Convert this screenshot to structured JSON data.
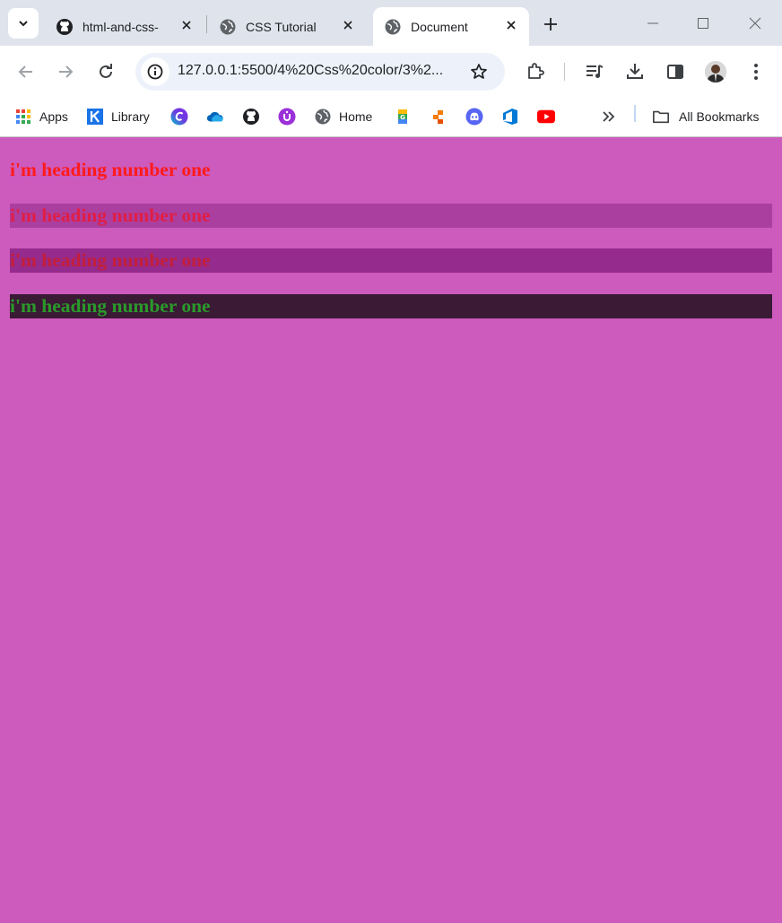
{
  "browser": {
    "tabs": [
      {
        "label": "html-and-css-",
        "icon": "github-icon"
      },
      {
        "label": "CSS Tutorial",
        "icon": "globe-icon"
      },
      {
        "label": "Document",
        "icon": "globe-icon",
        "active": true
      }
    ],
    "address_bar": {
      "url": "127.0.0.1:5500/4%20Css%20color/3%2..."
    },
    "bookmarks": [
      {
        "label": "Apps",
        "icon": "apps-grid-icon"
      },
      {
        "label": "Library",
        "icon": "library-icon"
      },
      {
        "label": "",
        "icon": "canva-icon"
      },
      {
        "label": "",
        "icon": "onedrive-icon"
      },
      {
        "label": "",
        "icon": "github-icon"
      },
      {
        "label": "",
        "icon": "extension-u-icon"
      },
      {
        "label": "Home",
        "icon": "globe-icon"
      },
      {
        "label": "",
        "icon": "google-apps-icon"
      },
      {
        "label": "",
        "icon": "orange-app-icon"
      },
      {
        "label": "",
        "icon": "discord-icon"
      },
      {
        "label": "",
        "icon": "azure-devops-icon"
      },
      {
        "label": "",
        "icon": "youtube-icon"
      }
    ],
    "all_bookmarks_label": "All Bookmarks"
  },
  "page": {
    "background_color": "#cd5abd",
    "headings": [
      {
        "text": "i'm heading number one",
        "color": "#ff1a1a",
        "background": "transparent"
      },
      {
        "text": "i'm heading number one",
        "color": "#e01e45",
        "background": "#ab3fa0"
      },
      {
        "text": "i'm heading number one",
        "color": "#c41e3a",
        "background": "#952b8c"
      },
      {
        "text": "i'm heading number one",
        "color": "#2a9a2a",
        "background": "#3a1a34"
      }
    ]
  }
}
